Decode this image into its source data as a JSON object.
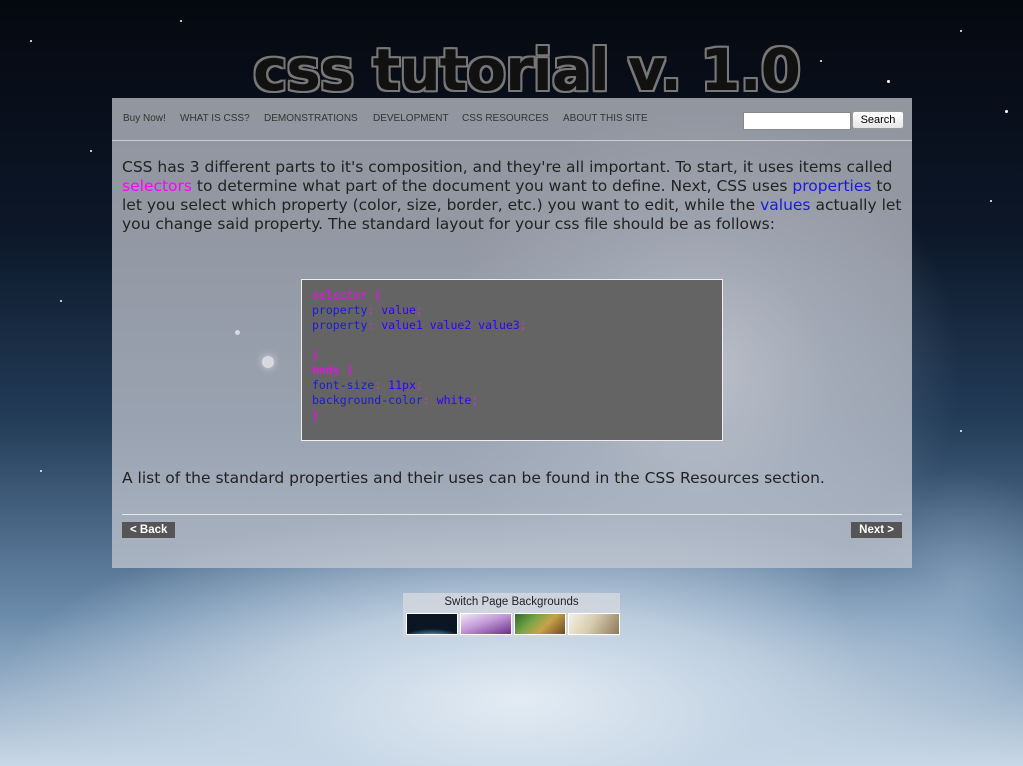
{
  "site": {
    "title": "css tutorial v. 1.0"
  },
  "nav": {
    "items": [
      {
        "label": "Buy Now!"
      },
      {
        "label": "WHAT IS CSS?"
      },
      {
        "label": "DEMONSTRATIONS"
      },
      {
        "label": "DEVELOPMENT"
      },
      {
        "label": "CSS RESOURCES"
      },
      {
        "label": "ABOUT THIS SITE"
      }
    ],
    "search": {
      "value": "",
      "button_label": "Search"
    }
  },
  "content": {
    "intro": {
      "p1": "CSS has 3 different parts to it's composition, and they're all important. To start, it uses items called ",
      "selectors": "selectors",
      "p2": " to determine what part of the document you want to define. Next, CSS uses ",
      "properties": "properties",
      "p3": " to let you select which property (color, size, border, etc.) you want to edit, while the ",
      "values": "values",
      "p4": " actually let you change said property. The standard layout for your css file should be as follows:"
    },
    "code": {
      "l1_sel": "selector",
      "l1_brace": " {",
      "l2_prop": "property",
      "l2_colon": ": ",
      "l2_val": "value",
      "l2_semi": ";",
      "l3_prop": "property",
      "l3_colon": ": ",
      "l3_val": "value1 value2 value3",
      "l3_semi": ";",
      "l5_close": "}",
      "l6_sel": "body",
      "l6_brace": " {",
      "l7_prop": "font-size",
      "l7_colon": ": ",
      "l7_val": "11px",
      "l7_semi": ";",
      "l8_prop": "background-color",
      "l8_colon": ": ",
      "l8_val": "white",
      "l8_semi": ";",
      "l9_close": "}"
    },
    "outro": "A list of the standard properties and their uses can be found in the CSS Resources section."
  },
  "pager": {
    "back_label": "< Back",
    "next_label": "Next >"
  },
  "switcher": {
    "title": "Switch Page Backgrounds"
  },
  "colors": {
    "selector": "#ff00ff",
    "property": "#1a1adc",
    "code_background": "#646464",
    "button_background": "#555555"
  }
}
